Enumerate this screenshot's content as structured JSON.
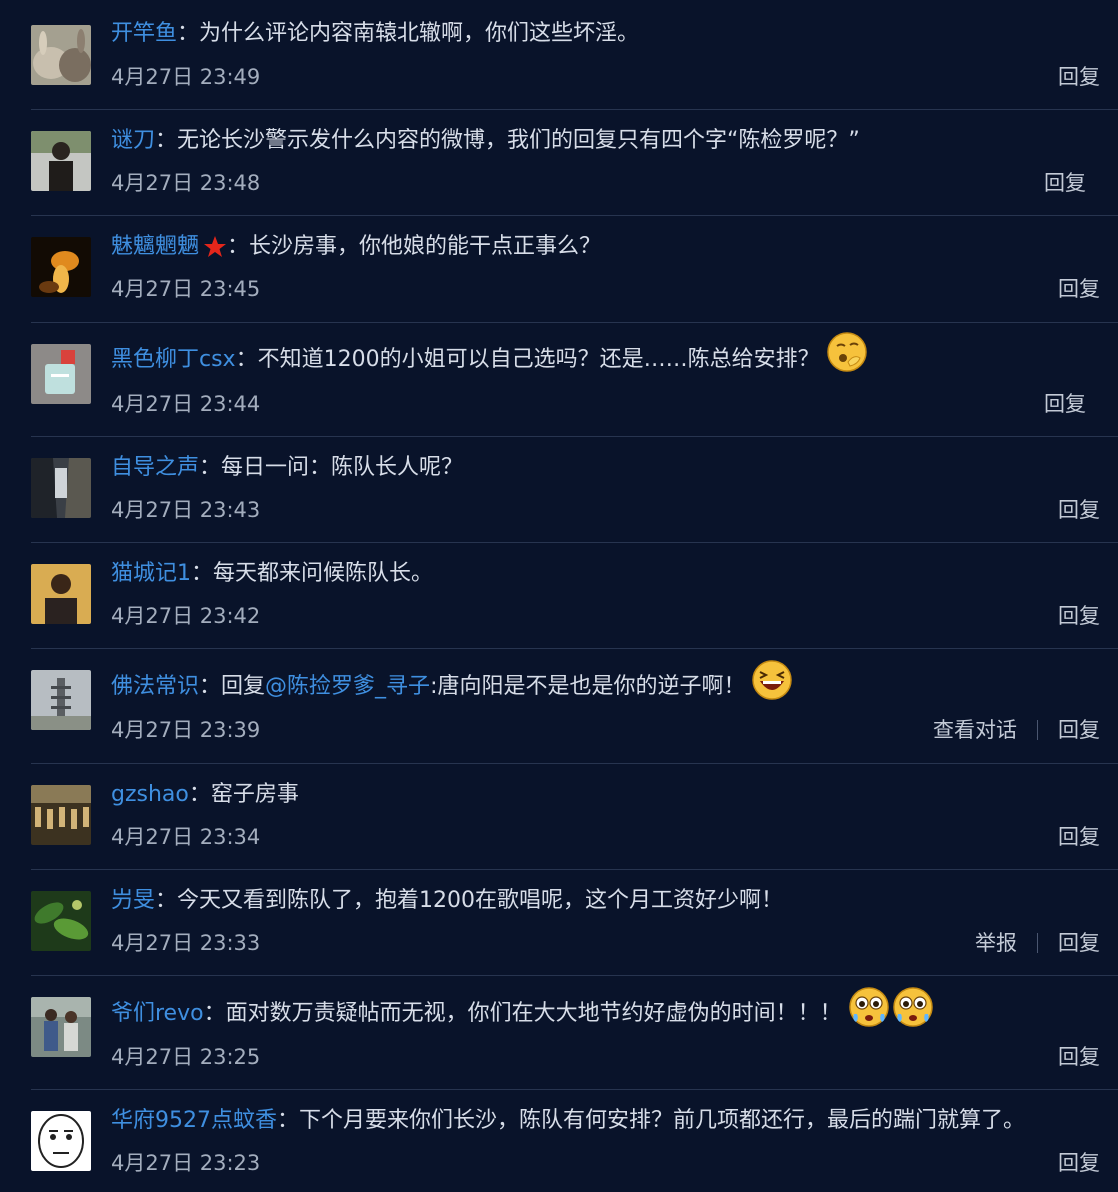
{
  "comments": [
    {
      "author": "开竿鱼",
      "colon": "：",
      "text": "为什么评论内容南辕北辙啊，你们这些坏淫。",
      "time": "4月27日 23:49",
      "reply": "回复"
    },
    {
      "author": "谜刀",
      "colon": "：",
      "text": "无论长沙警示发什么内容的微博，我们的回复只有四个字“陈检罗呢？”",
      "time": "4月27日 23:48",
      "reply": "回复"
    },
    {
      "author": "魅魑魍魉",
      "colon": "：",
      "text": "长沙房事，你他娘的能干点正事么？",
      "time": "4月27日 23:45",
      "reply": "回复"
    },
    {
      "author": "黑色柳丁csx",
      "colon": "：",
      "text": "不知道1200的小姐可以自己选吗？还是……陈总给安排？",
      "time": "4月27日 23:44",
      "reply": "回复"
    },
    {
      "author": "自导之声",
      "colon": "：",
      "text": "每日一问：陈队长人呢？",
      "time": "4月27日 23:43",
      "reply": "回复"
    },
    {
      "author": "猫城记1",
      "colon": "：",
      "text": "每天都来问候陈队长。",
      "time": "4月27日 23:42",
      "reply": "回复"
    },
    {
      "author": "佛法常识",
      "colon": "：",
      "prefix": "回复",
      "mention": "@陈捡罗爹_寻子",
      "text": ":唐向阳是不是也是你的逆子啊！",
      "time": "4月27日 23:39",
      "extra": "查看对话",
      "reply": "回复"
    },
    {
      "author": "gzshao",
      "colon": "：",
      "text": "窑子房事",
      "time": "4月27日 23:34",
      "reply": "回复"
    },
    {
      "author": "屶旻",
      "colon": "：",
      "text": "今天又看到陈队了，抱着1200在歌唱呢，这个月工资好少啊！",
      "time": "4月27日 23:33",
      "extra": "举报",
      "reply": "回复"
    },
    {
      "author": "爷们revo",
      "colon": "：",
      "text": "面对数万责疑帖而无视，你们在大大地节约好虚伪的时间！！！",
      "time": "4月27日 23:25",
      "reply": "回复"
    },
    {
      "author": "华府9527点蚊香",
      "colon": "：",
      "text": "下个月要来你们长沙，陈队有何安排？前几项都还行，最后的踹门就算了。",
      "time": "4月27日 23:23",
      "reply": "回复"
    }
  ],
  "colors": {
    "background": "#09132a",
    "link": "#3f8fe0",
    "text": "#d7dde8",
    "time": "#a3adbd",
    "divider": "#27344f"
  }
}
